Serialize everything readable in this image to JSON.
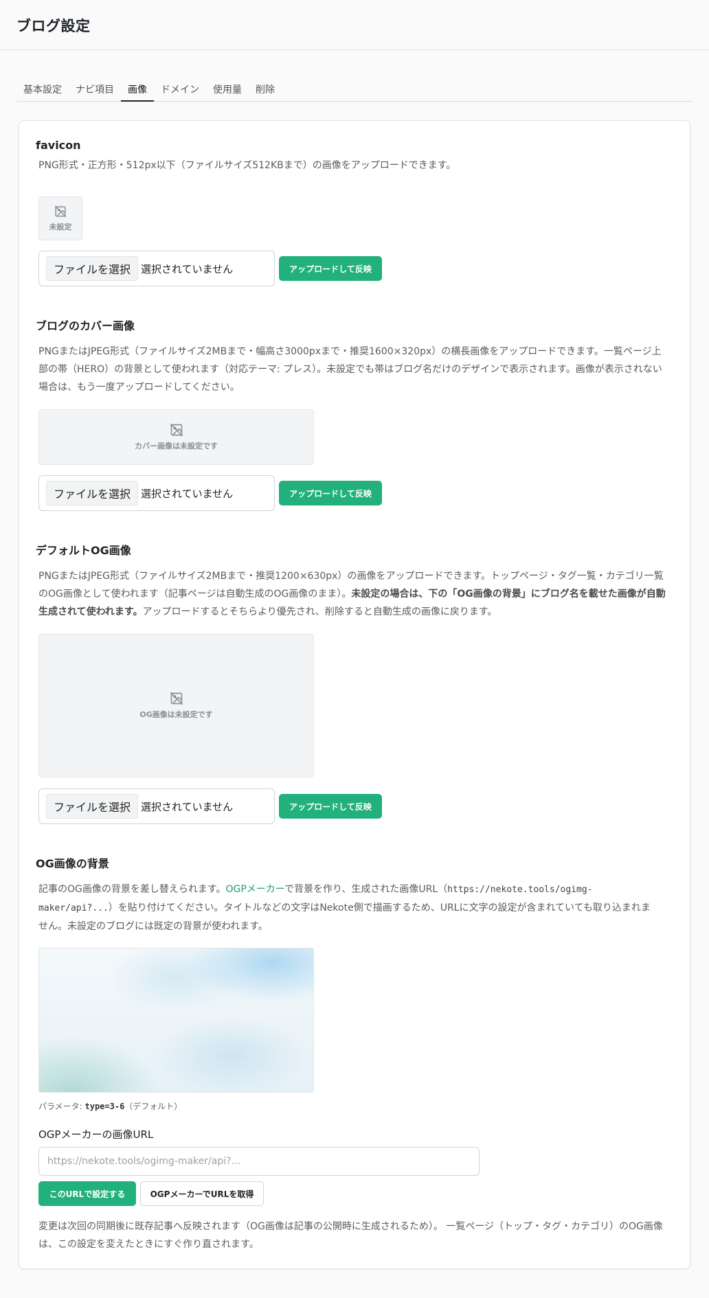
{
  "page": {
    "title": "ブログ設定"
  },
  "tabs": [
    {
      "label": "基本設定",
      "active": false
    },
    {
      "label": "ナビ項目",
      "active": false
    },
    {
      "label": "画像",
      "active": true
    },
    {
      "label": "ドメイン",
      "active": false
    },
    {
      "label": "使用量",
      "active": false
    },
    {
      "label": "削除",
      "active": false
    }
  ],
  "common": {
    "file_button": "ファイルを選択",
    "file_status": "選択されていません",
    "upload_button": "アップロードして反映"
  },
  "favicon": {
    "title": "favicon",
    "desc": "PNG形式・正方形・512px以下（ファイルサイズ512KBまで）の画像をアップロードできます。",
    "placeholder": "未設定"
  },
  "cover": {
    "title": "ブログのカバー画像",
    "desc_line1": "PNGまたはJPEG形式（ファイルサイズ2MBまで・幅高さ3000pxまで・推奨1600×320px）の横長画像をアップロードできます。一覧ページ上",
    "desc_line2": "部の帯（HERO）の背景として使われます（対応テーマ: プレス）。未設定でも帯はブログ名だけのデザインで表示されます。画像が表示されない",
    "desc_line3": "場合は、もう一度アップロードしてください。",
    "placeholder": "カバー画像は未設定です"
  },
  "og_default": {
    "title": "デフォルトOG画像",
    "desc_line1": "PNGまたはJPEG形式（ファイルサイズ2MBまで・推奨1200×630px）の画像をアップロードできます。トップページ・タグ一覧・カテゴリ一覧",
    "desc_line2a": "のOG画像として使われます（記事ページは自動生成のOG画像のまま）。",
    "desc_line2b": "未設定の場合は、下の「OG画像の背景」にブログ名を載せた画像が自動",
    "desc_line3a": "生成されて使われます。",
    "desc_line3b": "アップロードするとそちらより優先され、削除すると自動生成の画像に戻ります。",
    "placeholder": "OG画像は未設定です"
  },
  "og_bg": {
    "title": "OG画像の背景",
    "desc_l1a": "記事のOG画像の背景を差し替えられます。",
    "desc_l1_link": "OGPメーカー",
    "desc_l1b": "で背景を作り、生成された画像URL（",
    "desc_l1_code": "https://nekote.tools/ogimg-",
    "desc_l2_code": "maker/api?...",
    "desc_l2b": "）を貼り付けてください。タイトルなどの文字はNekote側で描画するため、URLに文字の設定が含まれていても取り込まれま",
    "desc_l3": "せん。未設定のブログには既定の背景が使われます。",
    "param_label": "パラメータ: ",
    "param_value": "type=3-6",
    "param_suffix": "（デフォルト）",
    "url_label": "OGPメーカーの画像URL",
    "url_placeholder": "https://nekote.tools/ogimg-maker/api?...",
    "url_value": "",
    "set_button": "このURLで設定する",
    "get_button": "OGPメーカーでURLを取得",
    "note_line1": "変更は次回の同期後に既存記事へ反映されます（OG画像は記事の公開時に生成されるため）。 一覧ページ（トップ・タグ・カテゴリ）のOG画像",
    "note_line2": "は、この設定を変えたときにすぐ作り直されます。"
  },
  "colors": {
    "accent": "#22b07d",
    "link": "#1f9d6f"
  },
  "icons": {
    "image_placeholder": "image-off-icon"
  }
}
